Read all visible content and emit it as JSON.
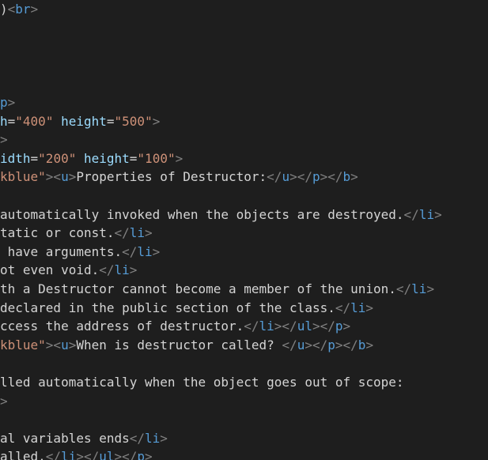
{
  "colors": {
    "background": "#1e1e1e",
    "text": "#d4d4d4",
    "tag": "#569cd6",
    "attribute": "#9cdcfe",
    "string": "#ce9178",
    "punctuation": "#808080"
  },
  "editor": {
    "lines": [
      {
        "tokens": [
          {
            "t": ")",
            "k": "text"
          },
          {
            "t": "<",
            "k": "punct"
          },
          {
            "t": "br",
            "k": "tag"
          },
          {
            "t": ">",
            "k": "punct"
          }
        ]
      },
      {
        "tokens": []
      },
      {
        "tokens": []
      },
      {
        "tokens": []
      },
      {
        "tokens": []
      },
      {
        "tokens": [
          {
            "t": "p",
            "k": "tag"
          },
          {
            "t": ">",
            "k": "punct"
          }
        ]
      },
      {
        "tokens": [
          {
            "t": "h",
            "k": "attr"
          },
          {
            "t": "=",
            "k": "text"
          },
          {
            "t": "\"400\"",
            "k": "val"
          },
          {
            "t": " ",
            "k": "text"
          },
          {
            "t": "height",
            "k": "attr"
          },
          {
            "t": "=",
            "k": "text"
          },
          {
            "t": "\"500\"",
            "k": "val"
          },
          {
            "t": ">",
            "k": "punct"
          }
        ]
      },
      {
        "tokens": [
          {
            "t": ">",
            "k": "punct"
          }
        ]
      },
      {
        "tokens": [
          {
            "t": "idth",
            "k": "attr"
          },
          {
            "t": "=",
            "k": "text"
          },
          {
            "t": "\"200\"",
            "k": "val"
          },
          {
            "t": " ",
            "k": "text"
          },
          {
            "t": "height",
            "k": "attr"
          },
          {
            "t": "=",
            "k": "text"
          },
          {
            "t": "\"100\"",
            "k": "val"
          },
          {
            "t": ">",
            "k": "punct"
          }
        ]
      },
      {
        "tokens": [
          {
            "t": "kblue\"",
            "k": "val"
          },
          {
            "t": "><",
            "k": "punct"
          },
          {
            "t": "u",
            "k": "tag"
          },
          {
            "t": ">",
            "k": "punct"
          },
          {
            "t": "Properties of Destructor:",
            "k": "text"
          },
          {
            "t": "</",
            "k": "punct"
          },
          {
            "t": "u",
            "k": "tag"
          },
          {
            "t": "></",
            "k": "punct"
          },
          {
            "t": "p",
            "k": "tag"
          },
          {
            "t": "></",
            "k": "punct"
          },
          {
            "t": "b",
            "k": "tag"
          },
          {
            "t": ">",
            "k": "punct"
          }
        ]
      },
      {
        "tokens": []
      },
      {
        "tokens": [
          {
            "t": "automatically invoked when the objects are destroyed.",
            "k": "text"
          },
          {
            "t": "</",
            "k": "punct"
          },
          {
            "t": "li",
            "k": "tag"
          },
          {
            "t": ">",
            "k": "punct"
          }
        ]
      },
      {
        "tokens": [
          {
            "t": "tatic or const.",
            "k": "text"
          },
          {
            "t": "</",
            "k": "punct"
          },
          {
            "t": "li",
            "k": "tag"
          },
          {
            "t": ">",
            "k": "punct"
          }
        ]
      },
      {
        "tokens": [
          {
            "t": " have arguments.",
            "k": "text"
          },
          {
            "t": "</",
            "k": "punct"
          },
          {
            "t": "li",
            "k": "tag"
          },
          {
            "t": ">",
            "k": "punct"
          }
        ]
      },
      {
        "tokens": [
          {
            "t": "ot even void.",
            "k": "text"
          },
          {
            "t": "</",
            "k": "punct"
          },
          {
            "t": "li",
            "k": "tag"
          },
          {
            "t": ">",
            "k": "punct"
          }
        ]
      },
      {
        "tokens": [
          {
            "t": "th a Destructor cannot become a member of the union.",
            "k": "text"
          },
          {
            "t": "</",
            "k": "punct"
          },
          {
            "t": "li",
            "k": "tag"
          },
          {
            "t": ">",
            "k": "punct"
          }
        ]
      },
      {
        "tokens": [
          {
            "t": "declared in the public section of the class.",
            "k": "text"
          },
          {
            "t": "</",
            "k": "punct"
          },
          {
            "t": "li",
            "k": "tag"
          },
          {
            "t": ">",
            "k": "punct"
          }
        ]
      },
      {
        "tokens": [
          {
            "t": "ccess the address of destructor.",
            "k": "text"
          },
          {
            "t": "</",
            "k": "punct"
          },
          {
            "t": "li",
            "k": "tag"
          },
          {
            "t": "></",
            "k": "punct"
          },
          {
            "t": "ul",
            "k": "tag"
          },
          {
            "t": "></",
            "k": "punct"
          },
          {
            "t": "p",
            "k": "tag"
          },
          {
            "t": ">",
            "k": "punct"
          }
        ]
      },
      {
        "tokens": [
          {
            "t": "kblue\"",
            "k": "val"
          },
          {
            "t": "><",
            "k": "punct"
          },
          {
            "t": "u",
            "k": "tag"
          },
          {
            "t": ">",
            "k": "punct"
          },
          {
            "t": "When is destructor called? ",
            "k": "text"
          },
          {
            "t": "</",
            "k": "punct"
          },
          {
            "t": "u",
            "k": "tag"
          },
          {
            "t": "></",
            "k": "punct"
          },
          {
            "t": "p",
            "k": "tag"
          },
          {
            "t": "></",
            "k": "punct"
          },
          {
            "t": "b",
            "k": "tag"
          },
          {
            "t": ">",
            "k": "punct"
          }
        ]
      },
      {
        "tokens": []
      },
      {
        "tokens": [
          {
            "t": "lled automatically when the object goes out of scope:",
            "k": "text"
          }
        ]
      },
      {
        "tokens": [
          {
            "t": ">",
            "k": "punct"
          }
        ]
      },
      {
        "tokens": []
      },
      {
        "tokens": [
          {
            "t": "al variables ends",
            "k": "text"
          },
          {
            "t": "</",
            "k": "punct"
          },
          {
            "t": "li",
            "k": "tag"
          },
          {
            "t": ">",
            "k": "punct"
          }
        ]
      },
      {
        "tokens": [
          {
            "t": "alled.",
            "k": "text"
          },
          {
            "t": "</",
            "k": "punct"
          },
          {
            "t": "li",
            "k": "tag"
          },
          {
            "t": "></",
            "k": "punct"
          },
          {
            "t": "ul",
            "k": "tag"
          },
          {
            "t": "></",
            "k": "punct"
          },
          {
            "t": "p",
            "k": "tag"
          },
          {
            "t": ">",
            "k": "punct"
          }
        ]
      }
    ]
  }
}
